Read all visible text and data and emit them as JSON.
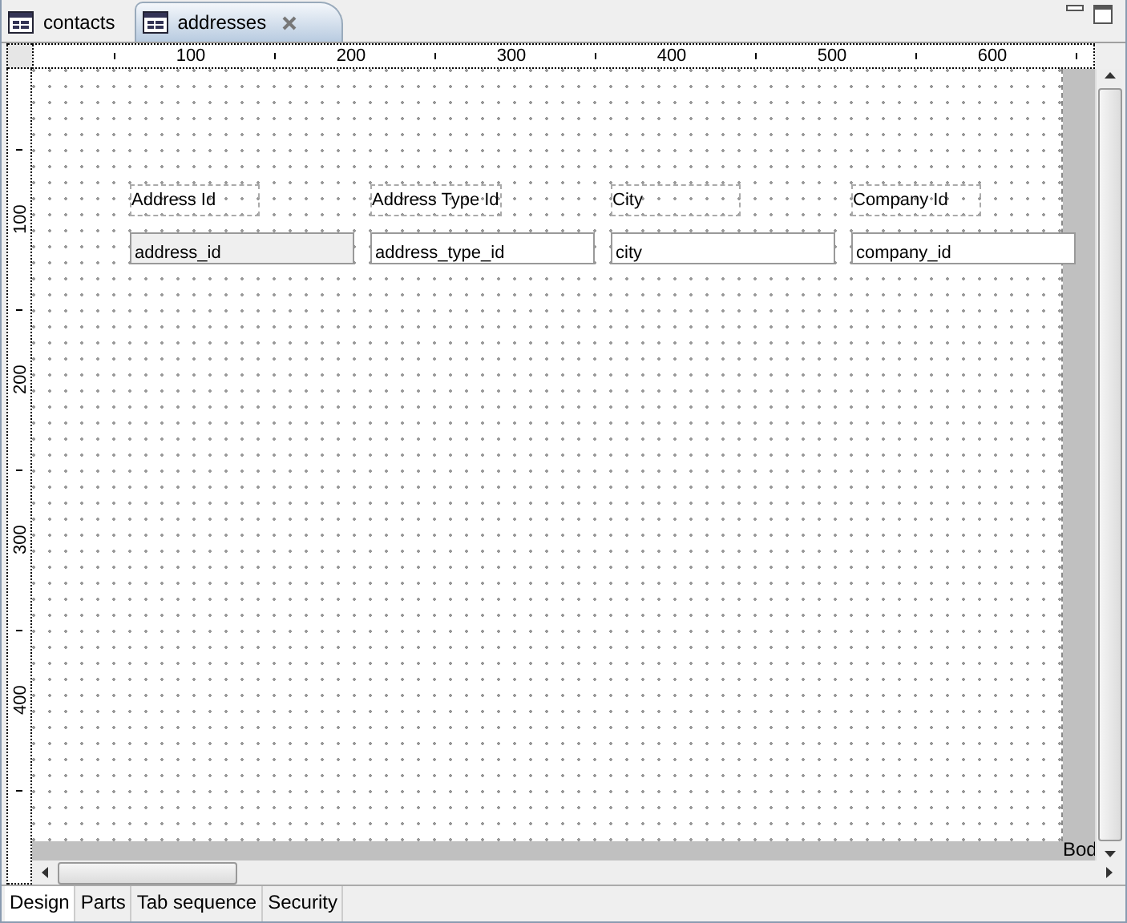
{
  "tabs": [
    {
      "label": "contacts",
      "selected": false,
      "closable": false
    },
    {
      "label": "addresses",
      "selected": true,
      "closable": true
    }
  ],
  "ruler": {
    "horizontal_labels": [
      "100",
      "200",
      "300",
      "400",
      "500",
      "600"
    ],
    "vertical_labels": [
      "100",
      "200",
      "300",
      "400"
    ]
  },
  "form": {
    "fields": [
      {
        "label": "Address Id",
        "value": "address_id",
        "selected": true
      },
      {
        "label": "Address Type Id",
        "value": "address_type_id",
        "selected": false
      },
      {
        "label": "City",
        "value": "city",
        "selected": false
      },
      {
        "label": "Company Id",
        "value": "company_id",
        "selected": false
      }
    ],
    "part_label": "Bod"
  },
  "bottom_tabs": [
    {
      "label": "Design",
      "selected": true
    },
    {
      "label": "Parts",
      "selected": false
    },
    {
      "label": "Tab sequence",
      "selected": false
    },
    {
      "label": "Security",
      "selected": false
    }
  ]
}
